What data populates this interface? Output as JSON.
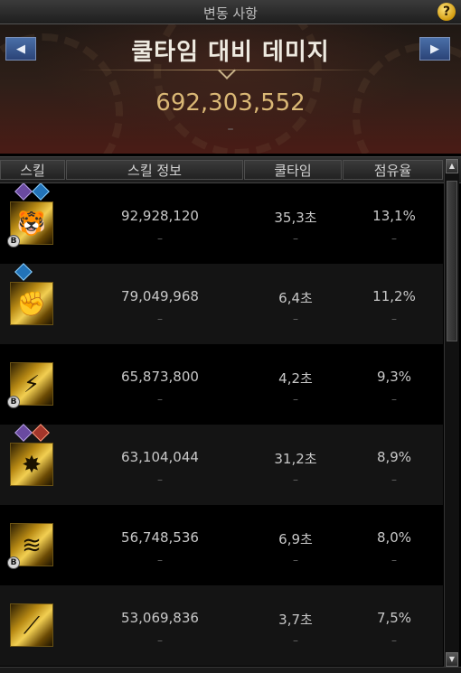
{
  "window": {
    "title": "변동 사항",
    "help_label": "?"
  },
  "banner": {
    "title": "쿨타임 대비 데미지",
    "value": "692,303,552",
    "sub": "–",
    "prev_label": "◀",
    "next_label": "▶"
  },
  "table": {
    "headers": [
      "스킬",
      "스킬 정보",
      "쿨타임",
      "점유율"
    ],
    "rows": [
      {
        "damage": "92,928,120",
        "cooldown": "35,3초",
        "share": "13,1%",
        "sub": "–",
        "badges": [
          "purple",
          "blue"
        ],
        "b_mark": true,
        "icon": "tiger-claw-icon"
      },
      {
        "damage": "79,049,968",
        "cooldown": "6,4초",
        "share": "11,2%",
        "sub": "–",
        "badges": [
          "blue"
        ],
        "b_mark": false,
        "icon": "fist-strike-icon"
      },
      {
        "damage": "65,873,800",
        "cooldown": "4,2초",
        "share": "9,3%",
        "sub": "–",
        "badges": [],
        "b_mark": true,
        "icon": "lightning-dash-icon"
      },
      {
        "damage": "63,104,044",
        "cooldown": "31,2초",
        "share": "8,9%",
        "sub": "–",
        "badges": [
          "purple",
          "red"
        ],
        "b_mark": false,
        "icon": "explosion-icon"
      },
      {
        "damage": "56,748,536",
        "cooldown": "6,9초",
        "share": "8,0%",
        "sub": "–",
        "badges": [],
        "b_mark": true,
        "icon": "dragon-roar-icon"
      },
      {
        "damage": "53,069,836",
        "cooldown": "3,7초",
        "share": "7,5%",
        "sub": "–",
        "badges": [],
        "b_mark": false,
        "icon": "slash-icon"
      }
    ]
  },
  "colors": {
    "accent_gold": "#d9b775",
    "banner_red": "#4a1c16"
  }
}
